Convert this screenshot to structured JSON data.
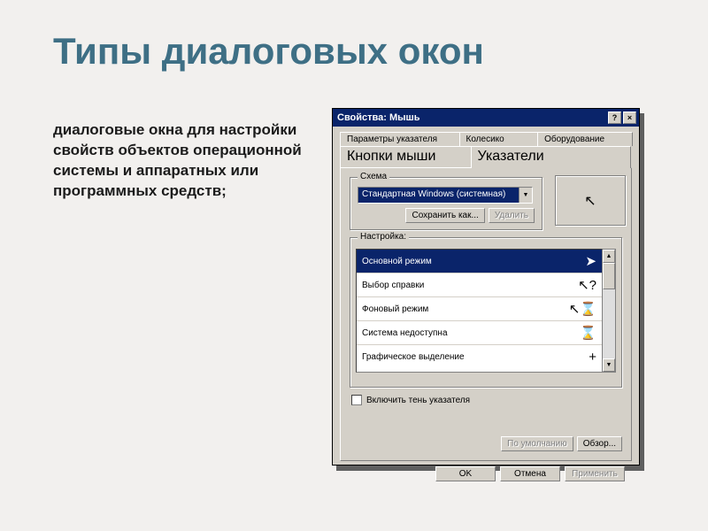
{
  "slide": {
    "title": "Типы диалоговых окон",
    "description": "диалоговые окна для настройки свойств объектов операционной системы и аппаратных или программных средств;"
  },
  "dialog": {
    "title": "Свойства: Мышь",
    "help_symbol": "?",
    "close_symbol": "×",
    "tabs_back": [
      "Параметры указателя",
      "Колесико",
      "Оборудование"
    ],
    "tabs_front": [
      "Кнопки мыши",
      "Указатели"
    ],
    "active_tab": "Указатели",
    "scheme": {
      "legend": "Схема",
      "combo_value": "Стандартная Windows (системная)",
      "save_as": "Сохранить как...",
      "delete": "Удалить"
    },
    "settings": {
      "legend": "Настройка:",
      "items": [
        {
          "label": "Основной режим",
          "icon": "arrow"
        },
        {
          "label": "Выбор справки",
          "icon": "arrow-help"
        },
        {
          "label": "Фоновый режим",
          "icon": "arrow-hourglass"
        },
        {
          "label": "Система недоступна",
          "icon": "hourglass"
        },
        {
          "label": "Графическое выделение",
          "icon": "crosshair"
        }
      ]
    },
    "shadow_checkbox": "Включить тень указателя",
    "default_btn": "По умолчанию",
    "browse_btn": "Обзор...",
    "footer": {
      "ok": "OK",
      "cancel": "Отмена",
      "apply": "Применить"
    }
  }
}
